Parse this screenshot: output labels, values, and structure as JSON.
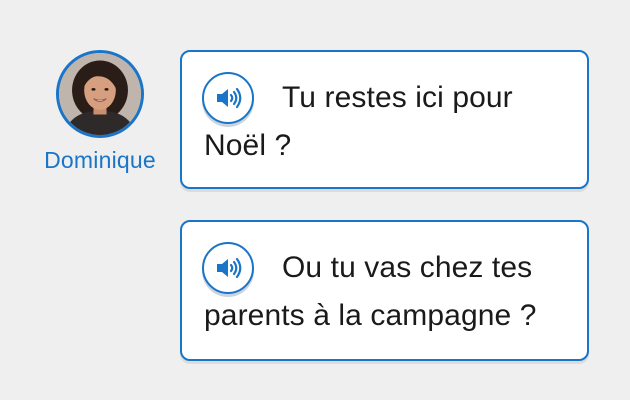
{
  "speaker": {
    "name": "Dominique",
    "avatar_icon": "person-photo-avatar"
  },
  "messages": [
    {
      "text": "Tu restes ici pour Noël ?",
      "audio_icon": "speaker-icon"
    },
    {
      "text": "Ou tu vas chez tes parents à la campagne ?",
      "audio_icon": "speaker-icon"
    }
  ],
  "colors": {
    "accent": "#1a74c7",
    "background": "#efefef",
    "bubble_bg": "#ffffff",
    "text": "#1a1a1a"
  }
}
